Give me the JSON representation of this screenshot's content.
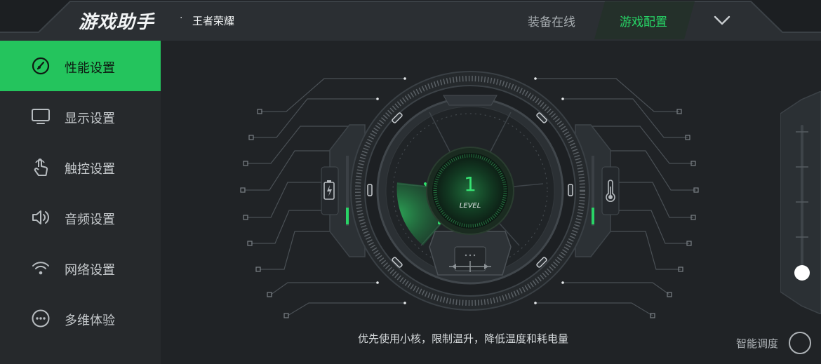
{
  "header": {
    "app_title": "游戏助手",
    "separator": "·",
    "game_name": "王者荣耀",
    "tabs": [
      {
        "label": "装备在线",
        "active": false
      },
      {
        "label": "游戏配置",
        "active": true
      }
    ],
    "accent_color": "#27d466"
  },
  "sidebar": {
    "items": [
      {
        "label": "性能设置",
        "icon": "gauge-icon",
        "active": true
      },
      {
        "label": "显示设置",
        "icon": "monitor-icon",
        "active": false
      },
      {
        "label": "触控设置",
        "icon": "touch-icon",
        "active": false
      },
      {
        "label": "音频设置",
        "icon": "speaker-icon",
        "active": false
      },
      {
        "label": "网络设置",
        "icon": "wifi-icon",
        "active": false
      },
      {
        "label": "多维体验",
        "icon": "more-icon",
        "active": false
      }
    ]
  },
  "performance": {
    "level_value": "1",
    "level_label": "LEVEL",
    "description": "优先使用小核，限制温升，降低温度和耗电量",
    "left_indicator_icon": "battery-icon",
    "right_indicator_icon": "thermometer-icon",
    "slider_level": 0.0,
    "smart_label": "智能调度",
    "smart_enabled": false
  }
}
